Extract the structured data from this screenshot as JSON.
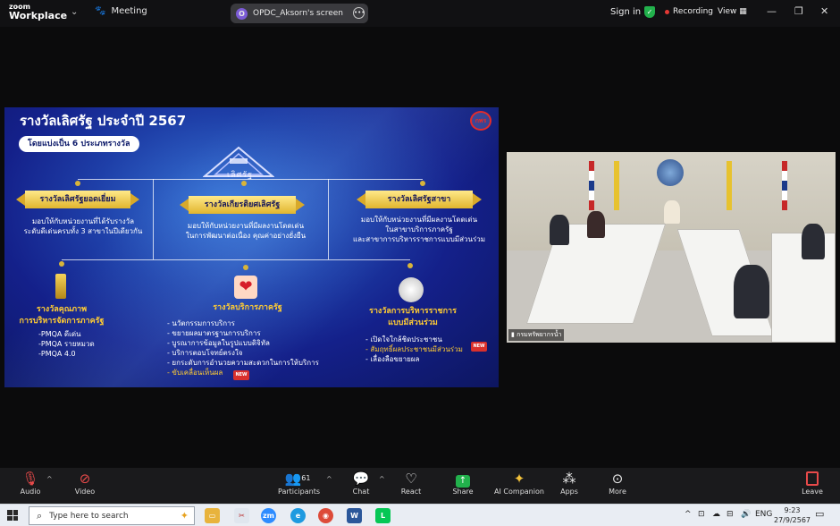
{
  "app": {
    "logo_line1": "zoom",
    "logo_line2": "Workplace"
  },
  "topbar": {
    "meeting_label": "Meeting",
    "screen_owner_initial": "O",
    "screen_share_label": "OPDC_Aksorn's screen",
    "sign_in": "Sign in",
    "recording": "Recording",
    "view": "View"
  },
  "slide": {
    "title": "รางวัลเลิศรัฐ ประจำปี 2567",
    "subtitle": "โดยแบ่งเป็น 6 ประเภทรางวัล",
    "logo": "กพร",
    "emblem_text": "เลิศรัฐ",
    "categories": [
      {
        "banner": "รางวัลเลิศรัฐยอดเยี่ยม",
        "desc": [
          "มอบให้กับหน่วยงานที่ได้รับรางวัล",
          "ระดับดีเด่นครบทั้ง 3 สาขาในปีเดียวกัน"
        ]
      },
      {
        "banner": "รางวัลเกียรติยศเลิศรัฐ",
        "desc": [
          "มอบให้กับหน่วยงานที่มีผลงานโดดเด่น",
          "ในการพัฒนาต่อเนื่อง คุณค่าอย่างยั่งยืน"
        ]
      },
      {
        "banner": "รางวัลเลิศรัฐสาขา",
        "desc": [
          "มอบให้กับหน่วยงานที่มีผลงานโดดเด่น",
          "ในสาขาบริการภาครัฐ",
          "และสาขาการบริหารราชการแบบมีส่วนร่วม"
        ]
      }
    ],
    "awards": [
      {
        "title": [
          "รางวัลคุณภาพ",
          "การบริหารจัดการภาครัฐ"
        ],
        "items": [
          "-PMQA ดีเด่น",
          "-PMQA รายหมวด",
          "-PMQA 4.0"
        ]
      },
      {
        "title": [
          "รางวัลบริการภาครัฐ"
        ],
        "items": [
          "- นวัตกรรมการบริการ",
          "- ขยายผลมาตรฐานการบริการ",
          "- บูรณาการข้อมูลในรูปแบบดิจิทัล",
          "- บริการตอบโจทย์ตรงใจ",
          "- ยกระดับการอำนวยความสะดวกในการให้บริการ",
          "- ขับเคลื่อนเห็นผล"
        ],
        "highlight_index": 5,
        "new_badge": "NEW"
      },
      {
        "title": [
          "รางวัลการบริหารราชการ",
          "แบบมีส่วนร่วม"
        ],
        "items": [
          "- เปิดใจใกล้ชิดประชาชน",
          "- สัมฤทธิ์ผลประชาชนมีส่วนร่วม",
          "- เลื่องลือขยายผล"
        ],
        "highlight_index": 1,
        "new_badge": "NEW"
      }
    ]
  },
  "video": {
    "participant_label": "กรมทรัพยากรน้ำ"
  },
  "toolbar": {
    "audio": "Audio",
    "video": "Video",
    "participants": "Participants",
    "participants_count": "61",
    "chat": "Chat",
    "react": "React",
    "share": "Share",
    "ai_companion": "AI Companion",
    "apps": "Apps",
    "more": "More",
    "leave": "Leave"
  },
  "taskbar": {
    "search_placeholder": "Type here to search",
    "lang": "ENG",
    "time": "9:23",
    "date": "27/9/2567"
  }
}
